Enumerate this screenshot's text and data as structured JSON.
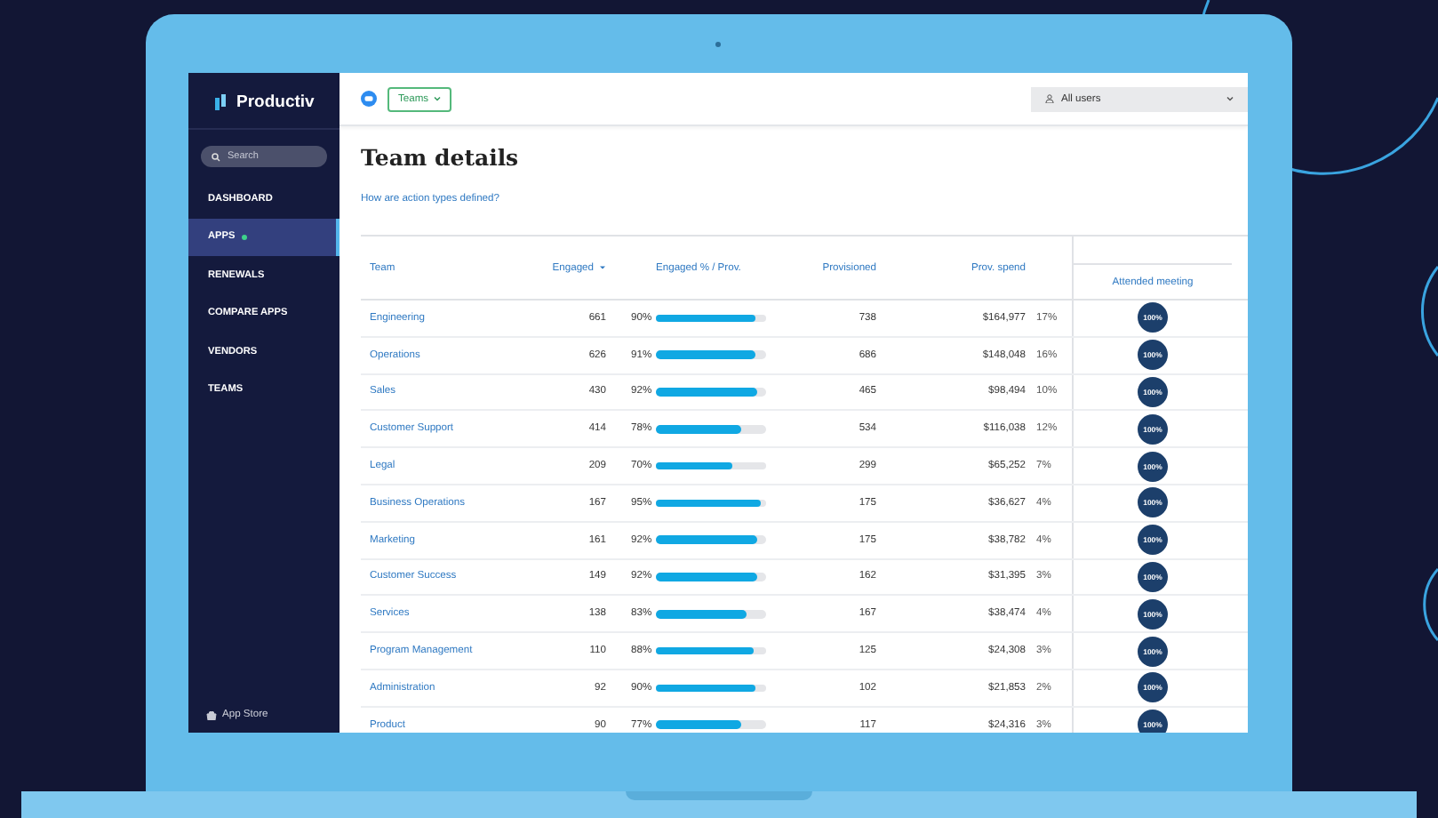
{
  "sidebar": {
    "logo": "Productiv",
    "search": {
      "placeholder": "Search"
    },
    "items": [
      {
        "label": "DASHBOARD",
        "selected": false,
        "dot": false
      },
      {
        "label": "APPS",
        "selected": true,
        "dot": true
      },
      {
        "label": "RENEWALS",
        "selected": false,
        "dot": false
      },
      {
        "label": "COMPARE APPS",
        "selected": false,
        "dot": false
      },
      {
        "label": "VENDORS",
        "selected": false,
        "dot": false
      },
      {
        "label": "TEAMS",
        "selected": false,
        "dot": false
      }
    ],
    "footer": "App Store"
  },
  "topbar": {
    "filter": "Teams",
    "users": "All users"
  },
  "page": {
    "title": "Team details",
    "help_link": "How are action types defined?"
  },
  "table": {
    "columns": [
      "Team",
      "Engaged",
      "Engaged % / Prov.",
      "Provisioned",
      "Prov. spend",
      "Attended meeting"
    ],
    "rows": [
      {
        "team": "Engineering",
        "engaged": "661",
        "pct": "90%",
        "level": 0.9,
        "provisioned": "738",
        "spend": "$164,977",
        "spend_pct": "17%",
        "attended": "100%"
      },
      {
        "team": "Operations",
        "engaged": "626",
        "pct": "91%",
        "level": 0.91,
        "provisioned": "686",
        "spend": "$148,048",
        "spend_pct": "16%",
        "attended": "100%"
      },
      {
        "team": "Sales",
        "engaged": "430",
        "pct": "92%",
        "level": 0.92,
        "provisioned": "465",
        "spend": "$98,494",
        "spend_pct": "10%",
        "attended": "100%"
      },
      {
        "team": "Customer Support",
        "engaged": "414",
        "pct": "78%",
        "level": 0.78,
        "provisioned": "534",
        "spend": "$116,038",
        "spend_pct": "12%",
        "attended": "100%"
      },
      {
        "team": "Legal",
        "engaged": "209",
        "pct": "70%",
        "level": 0.7,
        "provisioned": "299",
        "spend": "$65,252",
        "spend_pct": "7%",
        "attended": "100%"
      },
      {
        "team": "Business Operations",
        "engaged": "167",
        "pct": "95%",
        "level": 0.95,
        "provisioned": "175",
        "spend": "$36,627",
        "spend_pct": "4%",
        "attended": "100%"
      },
      {
        "team": "Marketing",
        "engaged": "161",
        "pct": "92%",
        "level": 0.92,
        "provisioned": "175",
        "spend": "$38,782",
        "spend_pct": "4%",
        "attended": "100%"
      },
      {
        "team": "Customer Success",
        "engaged": "149",
        "pct": "92%",
        "level": 0.92,
        "provisioned": "162",
        "spend": "$31,395",
        "spend_pct": "3%",
        "attended": "100%"
      },
      {
        "team": "Services",
        "engaged": "138",
        "pct": "83%",
        "level": 0.83,
        "provisioned": "167",
        "spend": "$38,474",
        "spend_pct": "4%",
        "attended": "100%"
      },
      {
        "team": "Program Management",
        "engaged": "110",
        "pct": "88%",
        "level": 0.88,
        "provisioned": "125",
        "spend": "$24,308",
        "spend_pct": "3%",
        "attended": "100%"
      },
      {
        "team": "Administration",
        "engaged": "92",
        "pct": "90%",
        "level": 0.9,
        "provisioned": "102",
        "spend": "$21,853",
        "spend_pct": "2%",
        "attended": "100%"
      },
      {
        "team": "Product",
        "engaged": "90",
        "pct": "77%",
        "level": 0.77,
        "provisioned": "117",
        "spend": "$24,316",
        "spend_pct": "3%",
        "attended": "100%"
      }
    ]
  }
}
